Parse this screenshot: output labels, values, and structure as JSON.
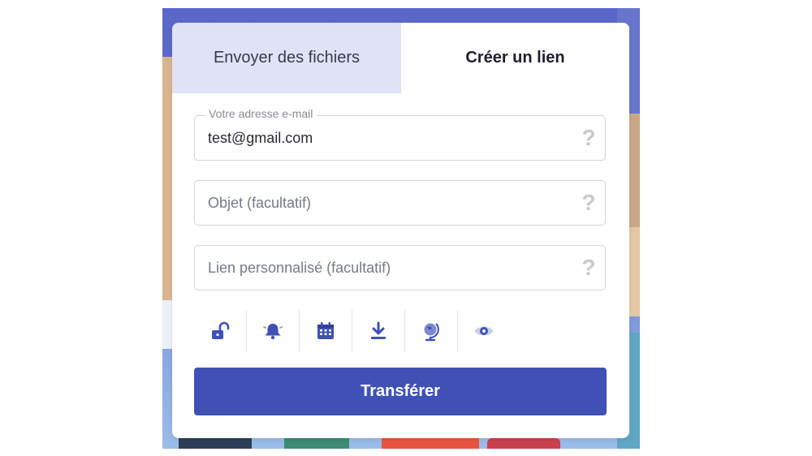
{
  "tabs": {
    "send_files": "Envoyer des fichiers",
    "create_link": "Créer un lien",
    "active": "create_link"
  },
  "form": {
    "email": {
      "label": "Votre adresse e-mail",
      "value": "test@gmail.com",
      "help": "?"
    },
    "subject": {
      "placeholder": "Objet (facultatif)",
      "help": "?"
    },
    "custom_link": {
      "placeholder": "Lien personnalisé (facultatif)",
      "help": "?"
    }
  },
  "options": [
    {
      "icon": "unlock-icon"
    },
    {
      "icon": "bell-icon"
    },
    {
      "icon": "calendar-icon"
    },
    {
      "icon": "download-icon"
    },
    {
      "icon": "globe-icon"
    },
    {
      "icon": "eye-icon"
    }
  ],
  "actions": {
    "transfer_label": "Transférer"
  },
  "colors": {
    "primary": "#3f51b5",
    "inactive_tab": "#dfe3f5",
    "background_illustration": "#5a67c9"
  }
}
